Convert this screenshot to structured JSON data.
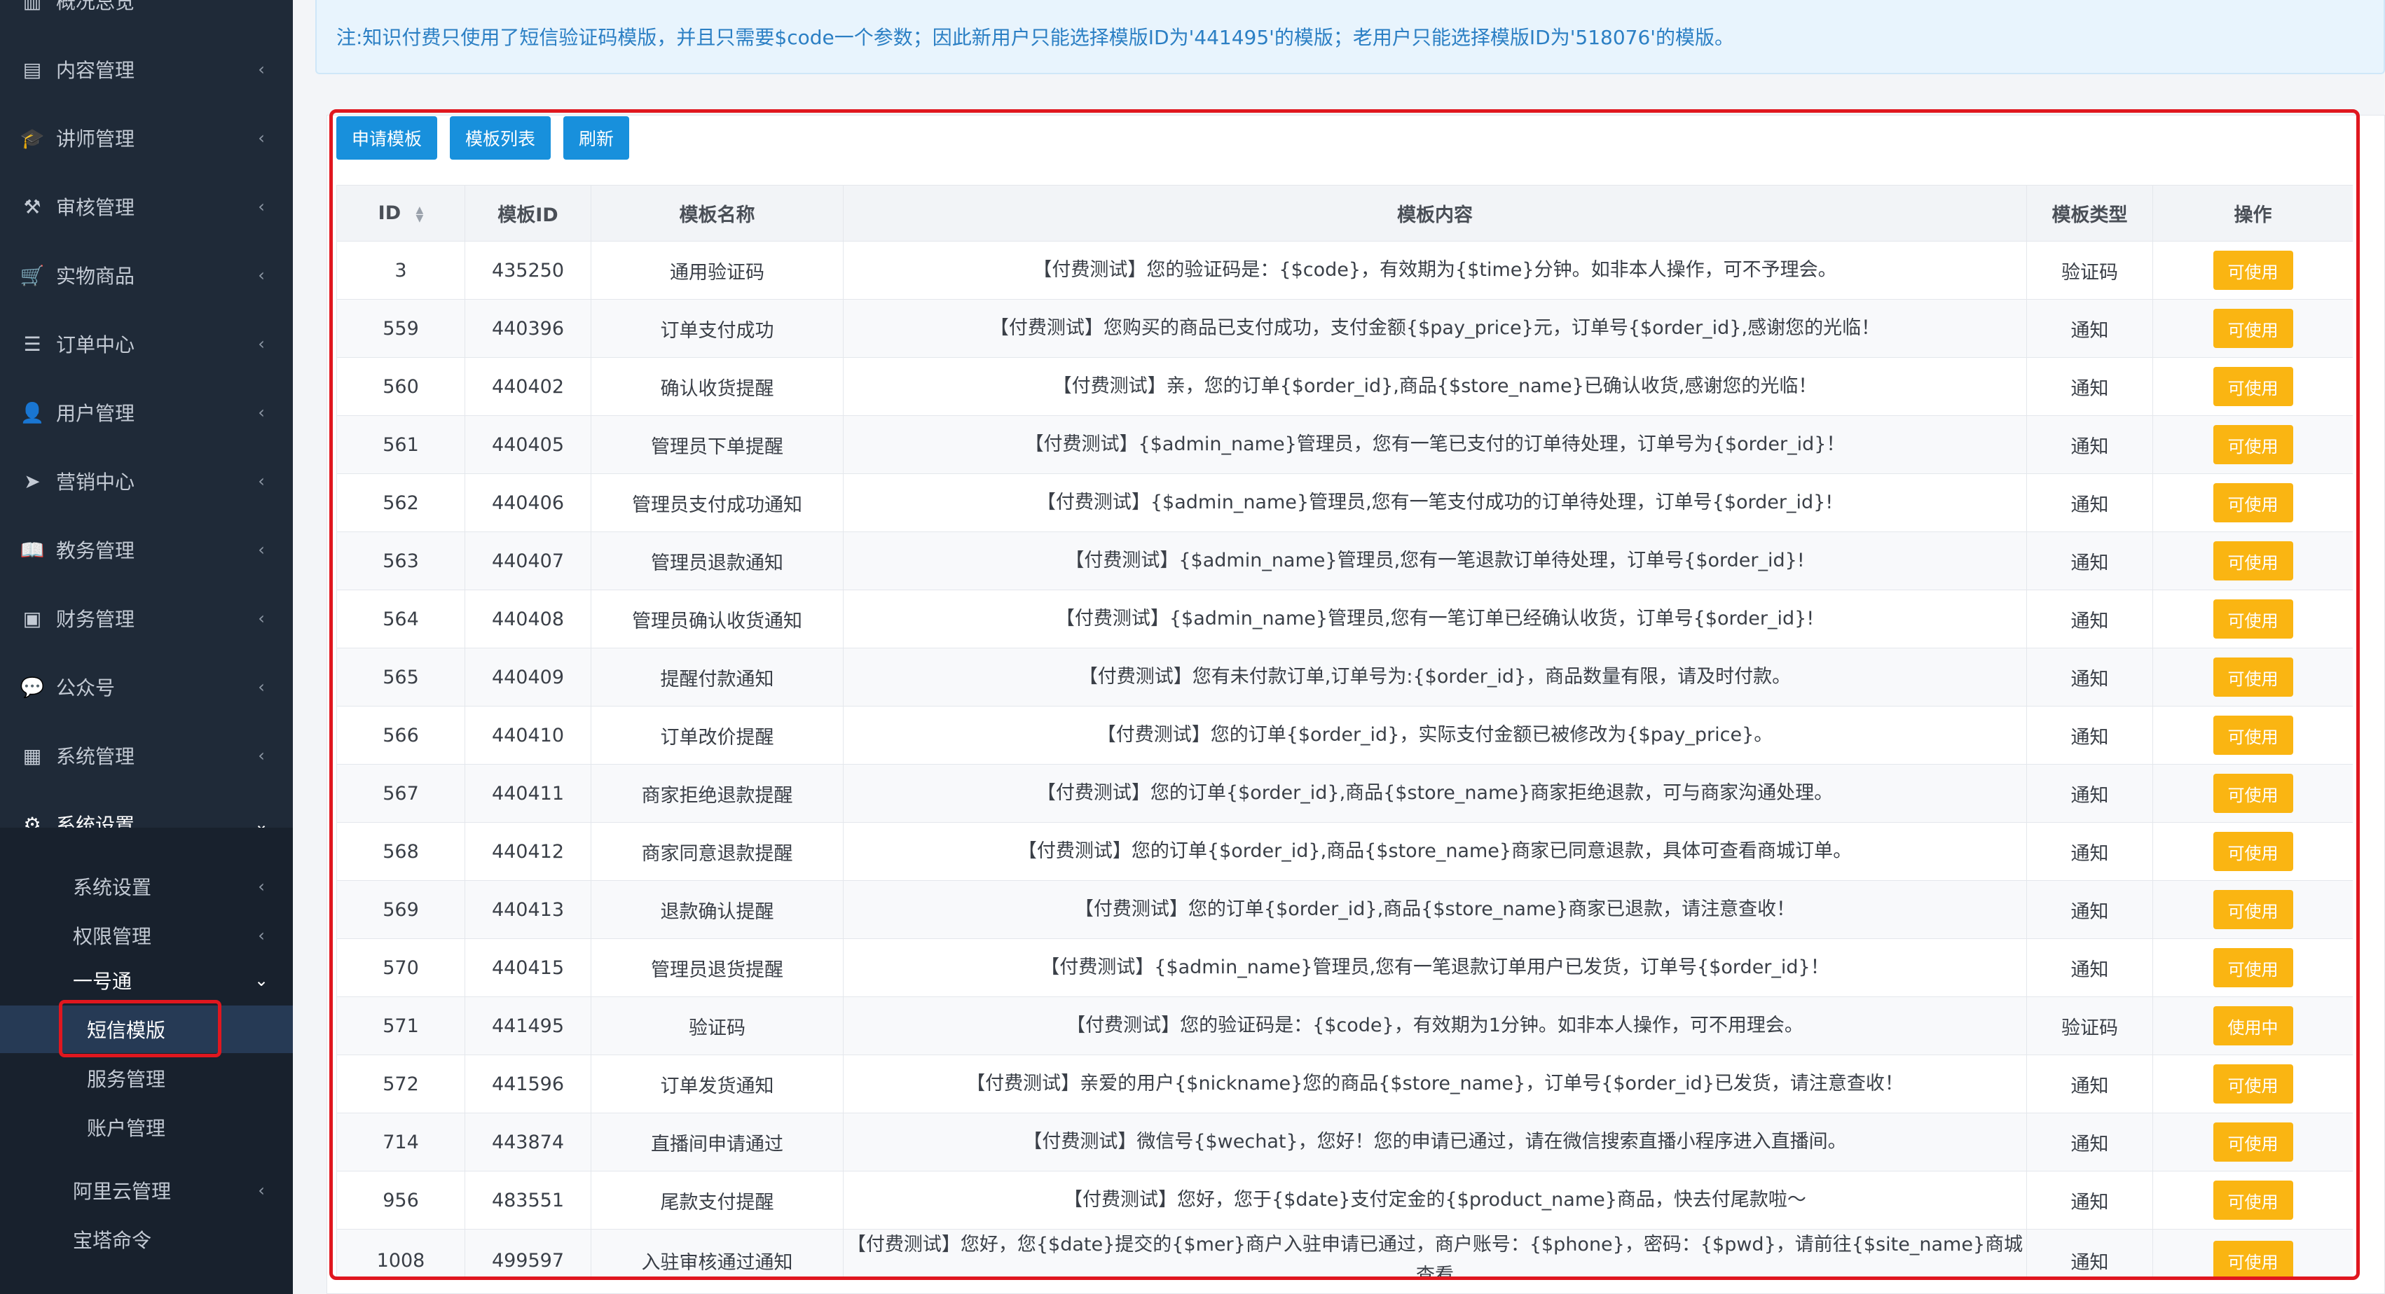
{
  "sidebar": {
    "top_partial": "概况总览",
    "items": [
      {
        "label": "内容管理",
        "icon": "newspaper-icon",
        "glyph": "▤"
      },
      {
        "label": "讲师管理",
        "icon": "graduation-cap-icon",
        "glyph": "🎓"
      },
      {
        "label": "审核管理",
        "icon": "gavel-icon",
        "glyph": "⚒"
      },
      {
        "label": "实物商品",
        "icon": "cart-icon",
        "glyph": "🛒"
      },
      {
        "label": "订单中心",
        "icon": "list-icon",
        "glyph": "☰"
      },
      {
        "label": "用户管理",
        "icon": "user-icon",
        "glyph": "👤"
      },
      {
        "label": "营销中心",
        "icon": "paper-plane-icon",
        "glyph": "➤"
      },
      {
        "label": "教务管理",
        "icon": "book-icon",
        "glyph": "📖"
      },
      {
        "label": "财务管理",
        "icon": "money-icon",
        "glyph": "▣"
      },
      {
        "label": "公众号",
        "icon": "wechat-icon",
        "glyph": "💬"
      },
      {
        "label": "系统管理",
        "icon": "grid-icon",
        "glyph": "▦"
      },
      {
        "label": "系统设置",
        "icon": "gear-icon",
        "glyph": "⚙"
      }
    ],
    "subitems": {
      "system_settings": "系统设置",
      "permission": "权限管理",
      "yihaotong": "一号通",
      "sms_template": "短信模版",
      "service": "服务管理",
      "account": "账户管理",
      "aliyun": "阿里云管理",
      "baota": "宝塔命令"
    }
  },
  "notice": "注:知识付费只使用了短信验证码模版，并且只需要$code一个参数；因此新用户只能选择模版ID为'441495'的模版；老用户只能选择模版ID为'518076'的模版。",
  "toolbar": {
    "apply": "申请模板",
    "list": "模板列表",
    "refresh": "刷新"
  },
  "table": {
    "headers": {
      "id": "ID",
      "template_id": "模板ID",
      "name": "模板名称",
      "content": "模板内容",
      "type": "模板类型",
      "action": "操作"
    },
    "rows": [
      {
        "id": "3",
        "tid": "435250",
        "name": "通用验证码",
        "content": "【付费测试】您的验证码是：{$code}，有效期为{$time}分钟。如非本人操作，可不予理会。",
        "type": "验证码",
        "action": "可使用"
      },
      {
        "id": "559",
        "tid": "440396",
        "name": "订单支付成功",
        "content": "【付费测试】您购买的商品已支付成功，支付金额{$pay_price}元，订单号{$order_id},感谢您的光临！",
        "type": "通知",
        "action": "可使用"
      },
      {
        "id": "560",
        "tid": "440402",
        "name": "确认收货提醒",
        "content": "【付费测试】亲，您的订单{$order_id},商品{$store_name}已确认收货,感谢您的光临！",
        "type": "通知",
        "action": "可使用"
      },
      {
        "id": "561",
        "tid": "440405",
        "name": "管理员下单提醒",
        "content": "【付费测试】{$admin_name}管理员，您有一笔已支付的订单待处理，订单号为{$order_id}！",
        "type": "通知",
        "action": "可使用"
      },
      {
        "id": "562",
        "tid": "440406",
        "name": "管理员支付成功通知",
        "content": "【付费测试】{$admin_name}管理员,您有一笔支付成功的订单待处理，订单号{$order_id}!",
        "type": "通知",
        "action": "可使用"
      },
      {
        "id": "563",
        "tid": "440407",
        "name": "管理员退款通知",
        "content": "【付费测试】{$admin_name}管理员,您有一笔退款订单待处理，订单号{$order_id}!",
        "type": "通知",
        "action": "可使用"
      },
      {
        "id": "564",
        "tid": "440408",
        "name": "管理员确认收货通知",
        "content": "【付费测试】{$admin_name}管理员,您有一笔订单已经确认收货，订单号{$order_id}!",
        "type": "通知",
        "action": "可使用"
      },
      {
        "id": "565",
        "tid": "440409",
        "name": "提醒付款通知",
        "content": "【付费测试】您有未付款订单,订单号为:{$order_id}，商品数量有限，请及时付款。",
        "type": "通知",
        "action": "可使用"
      },
      {
        "id": "566",
        "tid": "440410",
        "name": "订单改价提醒",
        "content": "【付费测试】您的订单{$order_id}，实际支付金额已被修改为{$pay_price}。",
        "type": "通知",
        "action": "可使用"
      },
      {
        "id": "567",
        "tid": "440411",
        "name": "商家拒绝退款提醒",
        "content": "【付费测试】您的订单{$order_id},商品{$store_name}商家拒绝退款，可与商家沟通处理。",
        "type": "通知",
        "action": "可使用"
      },
      {
        "id": "568",
        "tid": "440412",
        "name": "商家同意退款提醒",
        "content": "【付费测试】您的订单{$order_id},商品{$store_name}商家已同意退款，具体可查看商城订单。",
        "type": "通知",
        "action": "可使用"
      },
      {
        "id": "569",
        "tid": "440413",
        "name": "退款确认提醒",
        "content": "【付费测试】您的订单{$order_id},商品{$store_name}商家已退款，请注意查收！",
        "type": "通知",
        "action": "可使用"
      },
      {
        "id": "570",
        "tid": "440415",
        "name": "管理员退货提醒",
        "content": "【付费测试】{$admin_name}管理员,您有一笔退款订单用户已发货，订单号{$order_id}！",
        "type": "通知",
        "action": "可使用"
      },
      {
        "id": "571",
        "tid": "441495",
        "name": "验证码",
        "content": "【付费测试】您的验证码是：{$code}，有效期为1分钟。如非本人操作，可不用理会。",
        "type": "验证码",
        "action": "使用中"
      },
      {
        "id": "572",
        "tid": "441596",
        "name": "订单发货通知",
        "content": "【付费测试】亲爱的用户{$nickname}您的商品{$store_name}，订单号{$order_id}已发货，请注意查收！",
        "type": "通知",
        "action": "可使用"
      },
      {
        "id": "714",
        "tid": "443874",
        "name": "直播间申请通过",
        "content": "【付费测试】微信号{$wechat}，您好！您的申请已通过，请在微信搜索直播小程序进入直播间。",
        "type": "通知",
        "action": "可使用"
      },
      {
        "id": "956",
        "tid": "483551",
        "name": "尾款支付提醒",
        "content": "【付费测试】您好，您于{$date}支付定金的{$product_name}商品，快去付尾款啦～",
        "type": "通知",
        "action": "可使用"
      },
      {
        "id": "1008",
        "tid": "499597",
        "name": "入驻审核通过通知",
        "content": "【付费测试】您好，您{$date}提交的{$mer}商户入驻申请已通过，商户账号：{$phone}，密码：{$pwd}，请前往{$site_name}商城查看",
        "type": "通知",
        "action": "可使用"
      }
    ]
  },
  "colors": {
    "sidebar_bg": "#1f2a38",
    "primary_button": "#1890dc",
    "action_button": "#fab512",
    "highlight_border": "#e0171f",
    "notice_text": "#2b7fc4"
  }
}
